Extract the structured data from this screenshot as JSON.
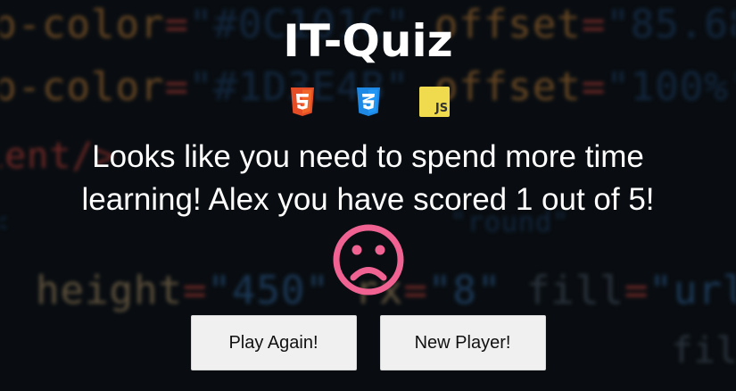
{
  "app": {
    "title": "IT-Quiz"
  },
  "tech_icons": [
    "html5-icon",
    "css3-icon",
    "javascript-icon"
  ],
  "javascript_badge_text": "JS",
  "result": {
    "line1": "Looks like you need to spend more time",
    "line2": "learning! Alex you have scored 1 out of 5!",
    "face": "sad-face-icon",
    "face_color": "#f06292"
  },
  "buttons": {
    "play_again": "Play Again!",
    "new_player": "New Player!"
  },
  "colors": {
    "html5": "#e44d26",
    "css3": "#1e88e5",
    "javascript": "#f0db4f",
    "button_bg": "#f0f0f0"
  }
}
